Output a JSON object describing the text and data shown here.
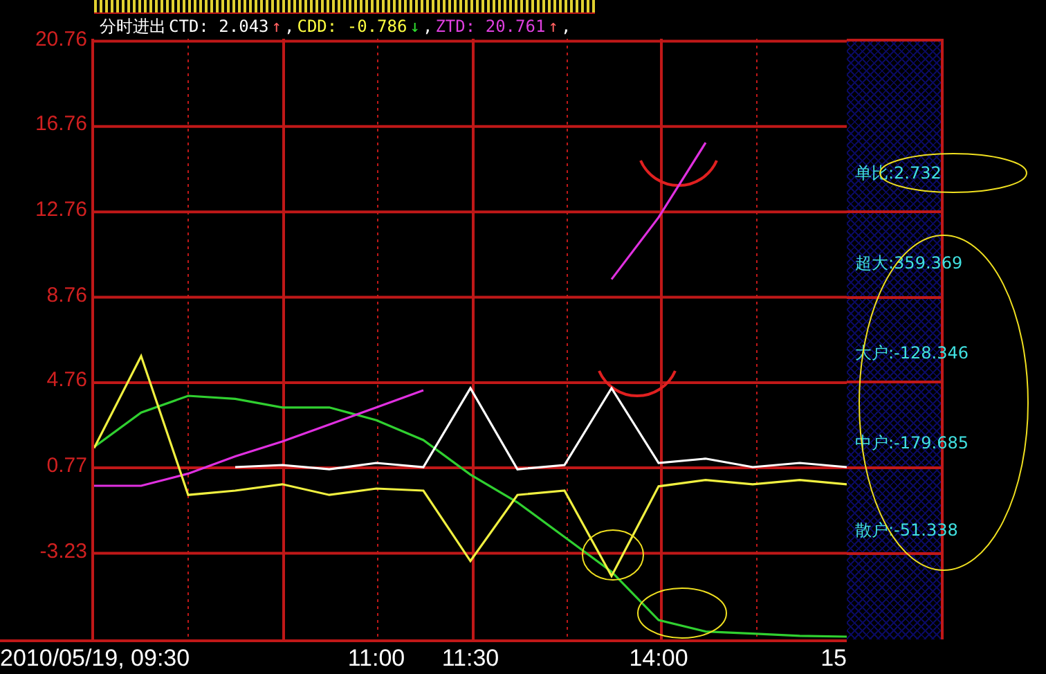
{
  "header": {
    "title": "分时进出",
    "indicators": [
      {
        "label": "CTD:",
        "value": "2.043",
        "color": "#ffffff",
        "arrow": {
          "text": "↑",
          "color": "#ff6060"
        },
        "separator": ","
      },
      {
        "label": "CDD:",
        "value": "-0.786",
        "color": "#ffff40",
        "arrow": {
          "text": "↓",
          "color": "#30e030"
        },
        "separator": ","
      },
      {
        "label": "ZTD:",
        "value": "20.761",
        "color": "#e040e0",
        "arrow": {
          "text": "↑",
          "color": "#ff6060"
        },
        "separator": ","
      }
    ]
  },
  "chart": {
    "chart_data": {
      "type": "line",
      "categories": [
        "2010/05/19, 09:30",
        null,
        null,
        null,
        null,
        null,
        "11:00",
        null,
        "11:30",
        null,
        null,
        null,
        "14:00",
        null,
        null,
        null,
        "15"
      ],
      "grid": true,
      "ylim": [
        -7.27,
        20.87
      ],
      "yticks": [
        {
          "value": 20.76,
          "label": "20.76"
        },
        {
          "value": 16.76,
          "label": "16.76"
        },
        {
          "value": 12.76,
          "label": "12.76"
        },
        {
          "value": 8.76,
          "label": "8.76"
        },
        {
          "value": 4.76,
          "label": "4.76"
        },
        {
          "value": 0.77,
          "label": "0.77"
        },
        {
          "value": -3.23,
          "label": "-3.23"
        }
      ],
      "series": [
        {
          "color": "#30d030",
          "values": [
            1.74,
            3.36,
            4.14,
            4.0,
            3.6,
            3.6,
            3.0,
            2.07,
            0.45,
            -0.85,
            -2.47,
            -4.1,
            -6.36,
            -6.9,
            -7.0,
            -7.1,
            -7.14
          ]
        },
        {
          "color": "#e030e0",
          "values": [
            -0.07,
            -0.07,
            0.5,
            1.3,
            2.0,
            2.8,
            3.6,
            4.4,
            null,
            null,
            null,
            9.6,
            12.5,
            16.0,
            null,
            null,
            null
          ]
        },
        {
          "color": "#f0f040",
          "values": [
            1.7,
            6.0,
            -0.5,
            -0.3,
            0.0,
            -0.5,
            -0.2,
            -0.3,
            -3.6,
            -0.5,
            -0.3,
            -4.3,
            -0.1,
            0.2,
            0.0,
            0.2,
            0.0
          ]
        },
        {
          "color": "#ffffff",
          "values": [
            null,
            null,
            null,
            0.8,
            0.9,
            0.7,
            1.0,
            0.8,
            4.5,
            0.7,
            0.9,
            4.5,
            1.0,
            1.2,
            0.8,
            1.0,
            0.8
          ]
        }
      ]
    }
  },
  "side_panel": [
    {
      "label": "单比:",
      "value": "2.732"
    },
    {
      "label": "超大:",
      "value": "359.369"
    },
    {
      "label": "大户:",
      "value": "-128.346"
    },
    {
      "label": "中户:",
      "value": "-179.685"
    },
    {
      "label": "散户:",
      "value": "-51.338"
    }
  ]
}
